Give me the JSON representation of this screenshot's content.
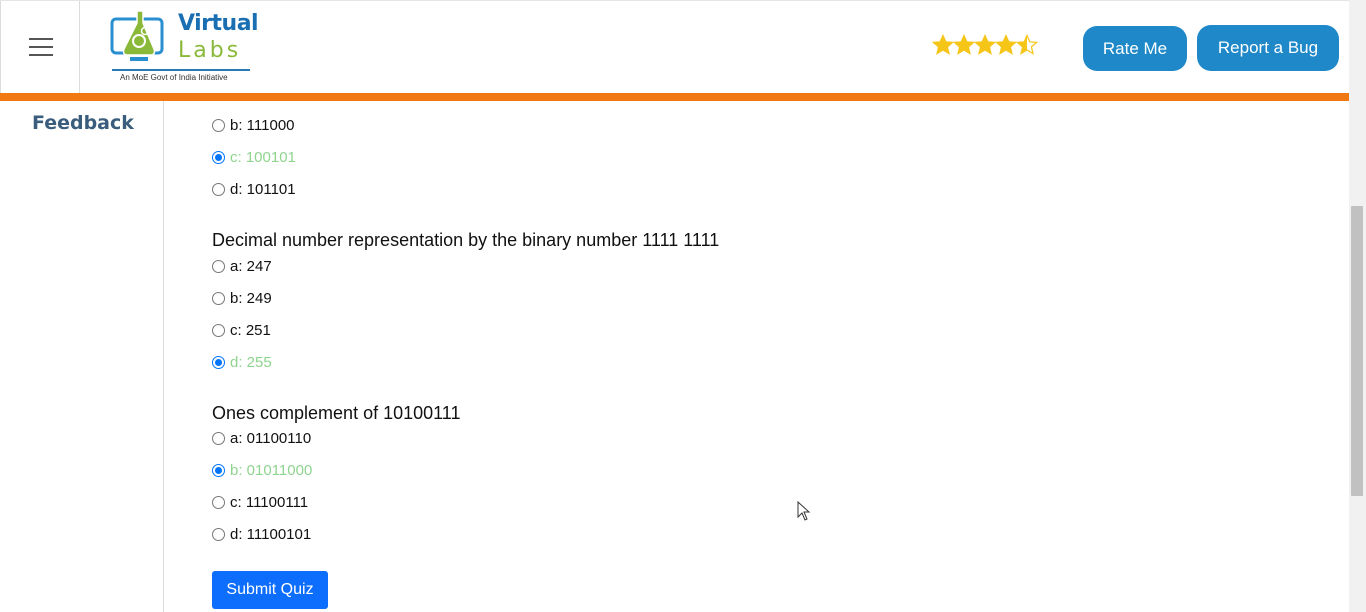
{
  "header": {
    "logo": {
      "line1": "Virtual",
      "line2": "Labs",
      "subtitle": "An MoE Govt of India Initiative"
    },
    "rating": {
      "value": 4.5,
      "max": 5
    },
    "rate_button": "Rate Me",
    "bug_button": "Report a Bug"
  },
  "sidebar": {
    "active_item": "Feedback"
  },
  "quiz": {
    "prev_question_options": [
      {
        "label": "b: 111000",
        "checked": false,
        "correct": false
      },
      {
        "label": "c: 100101",
        "checked": true,
        "correct": true
      },
      {
        "label": "d: 101101",
        "checked": false,
        "correct": false
      }
    ],
    "questions": [
      {
        "text": "Decimal number representation by the binary number 1111 1111",
        "options": [
          {
            "label": "a: 247",
            "checked": false,
            "correct": false
          },
          {
            "label": "b: 249",
            "checked": false,
            "correct": false
          },
          {
            "label": "c: 251",
            "checked": false,
            "correct": false
          },
          {
            "label": "d: 255",
            "checked": true,
            "correct": true
          }
        ]
      },
      {
        "text": "Ones complement of 10100111",
        "options": [
          {
            "label": "a: 01100110",
            "checked": false,
            "correct": false
          },
          {
            "label": "b: 01011000",
            "checked": true,
            "correct": true
          },
          {
            "label": "c: 11100111",
            "checked": false,
            "correct": false
          },
          {
            "label": "d: 11100101",
            "checked": false,
            "correct": false
          }
        ]
      }
    ],
    "submit_label": "Submit Quiz"
  },
  "colors": {
    "accent_blue": "#1e88c8",
    "orange_bar": "#f07a11",
    "correct_green": "#8fd48f",
    "submit_blue": "#0d6efd",
    "star_gold": "#f5c518"
  }
}
